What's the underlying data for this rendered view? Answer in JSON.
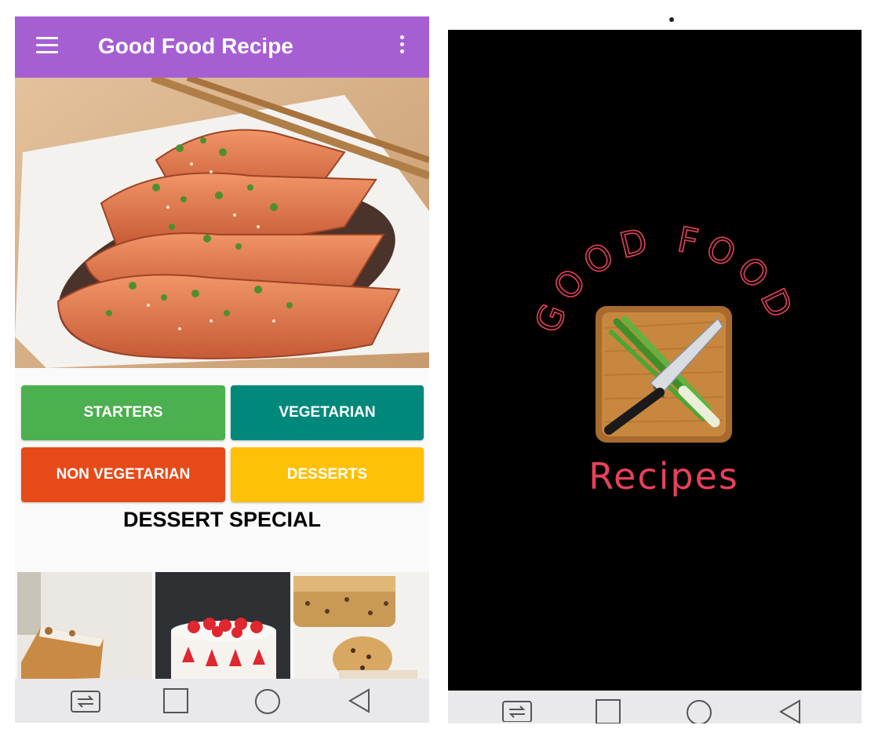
{
  "app": {
    "title": "Good Food Recipe",
    "accent_color": "#a65fd3"
  },
  "categories": [
    {
      "label": "STARTERS",
      "color": "#4caf50"
    },
    {
      "label": "VEGETARIAN",
      "color": "#00897b"
    },
    {
      "label": "NON VEGETARIAN",
      "color": "#e64a19"
    },
    {
      "label": "DESSERTS",
      "color": "#ffc107"
    }
  ],
  "section": {
    "title": "DESSERT SPECIAL"
  },
  "desserts": [
    {
      "image": "carrot-cake-slice"
    },
    {
      "image": "strawberry-cake"
    },
    {
      "image": "cookie-cheesecake"
    }
  ],
  "splash": {
    "brand_arc": "GOOD FOOD",
    "subtitle": "Recipes",
    "brand_color": "#e8415a",
    "logo_icon": "knife-cutting-board-icon"
  },
  "navbar_icons": [
    "switch-apps-icon",
    "square-recents-icon",
    "circle-home-icon",
    "triangle-back-icon"
  ]
}
